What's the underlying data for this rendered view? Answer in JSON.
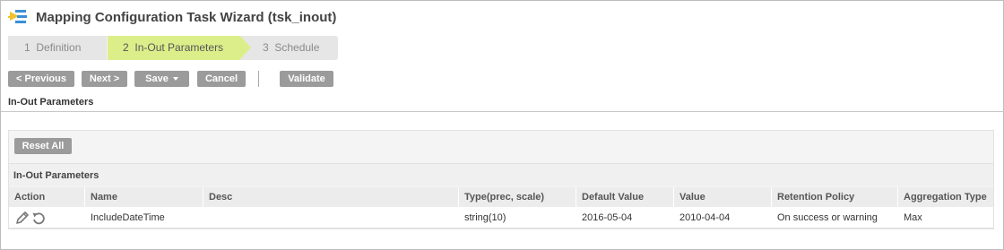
{
  "window": {
    "title": "Mapping Configuration Task Wizard (tsk_inout)"
  },
  "steps": [
    {
      "number": "1",
      "label": "Definition",
      "active": false
    },
    {
      "number": "2",
      "label": "In-Out Parameters",
      "active": true
    },
    {
      "number": "3",
      "label": "Schedule",
      "active": false
    }
  ],
  "toolbar": {
    "previous_label": "< Previous",
    "next_label": "Next >",
    "save_label": "Save",
    "cancel_label": "Cancel",
    "validate_label": "Validate"
  },
  "section": {
    "heading": "In-Out Parameters"
  },
  "panel": {
    "reset_label": "Reset All",
    "heading": "In-Out Parameters"
  },
  "table": {
    "columns": [
      "Action",
      "Name",
      "Desc",
      "Type(prec, scale)",
      "Default Value",
      "Value",
      "Retention Policy",
      "Aggregation Type"
    ],
    "rows": [
      {
        "name": "IncludeDateTime",
        "desc": "",
        "type": "string(10)",
        "default_value": "2016-05-04",
        "value": "2010-04-04",
        "retention_policy": "On success or warning",
        "aggregation_type": "Max"
      }
    ]
  },
  "colors": {
    "active_step": "#dcee8a",
    "inactive_step": "#e6e6e6",
    "button": "#9b9b9b",
    "logo_blue": "#3b8fd6",
    "logo_yellow": "#f2c12e"
  },
  "icons": {
    "logo": "wizard-logo-icon",
    "edit": "pencil-icon",
    "reset": "undo-icon"
  }
}
